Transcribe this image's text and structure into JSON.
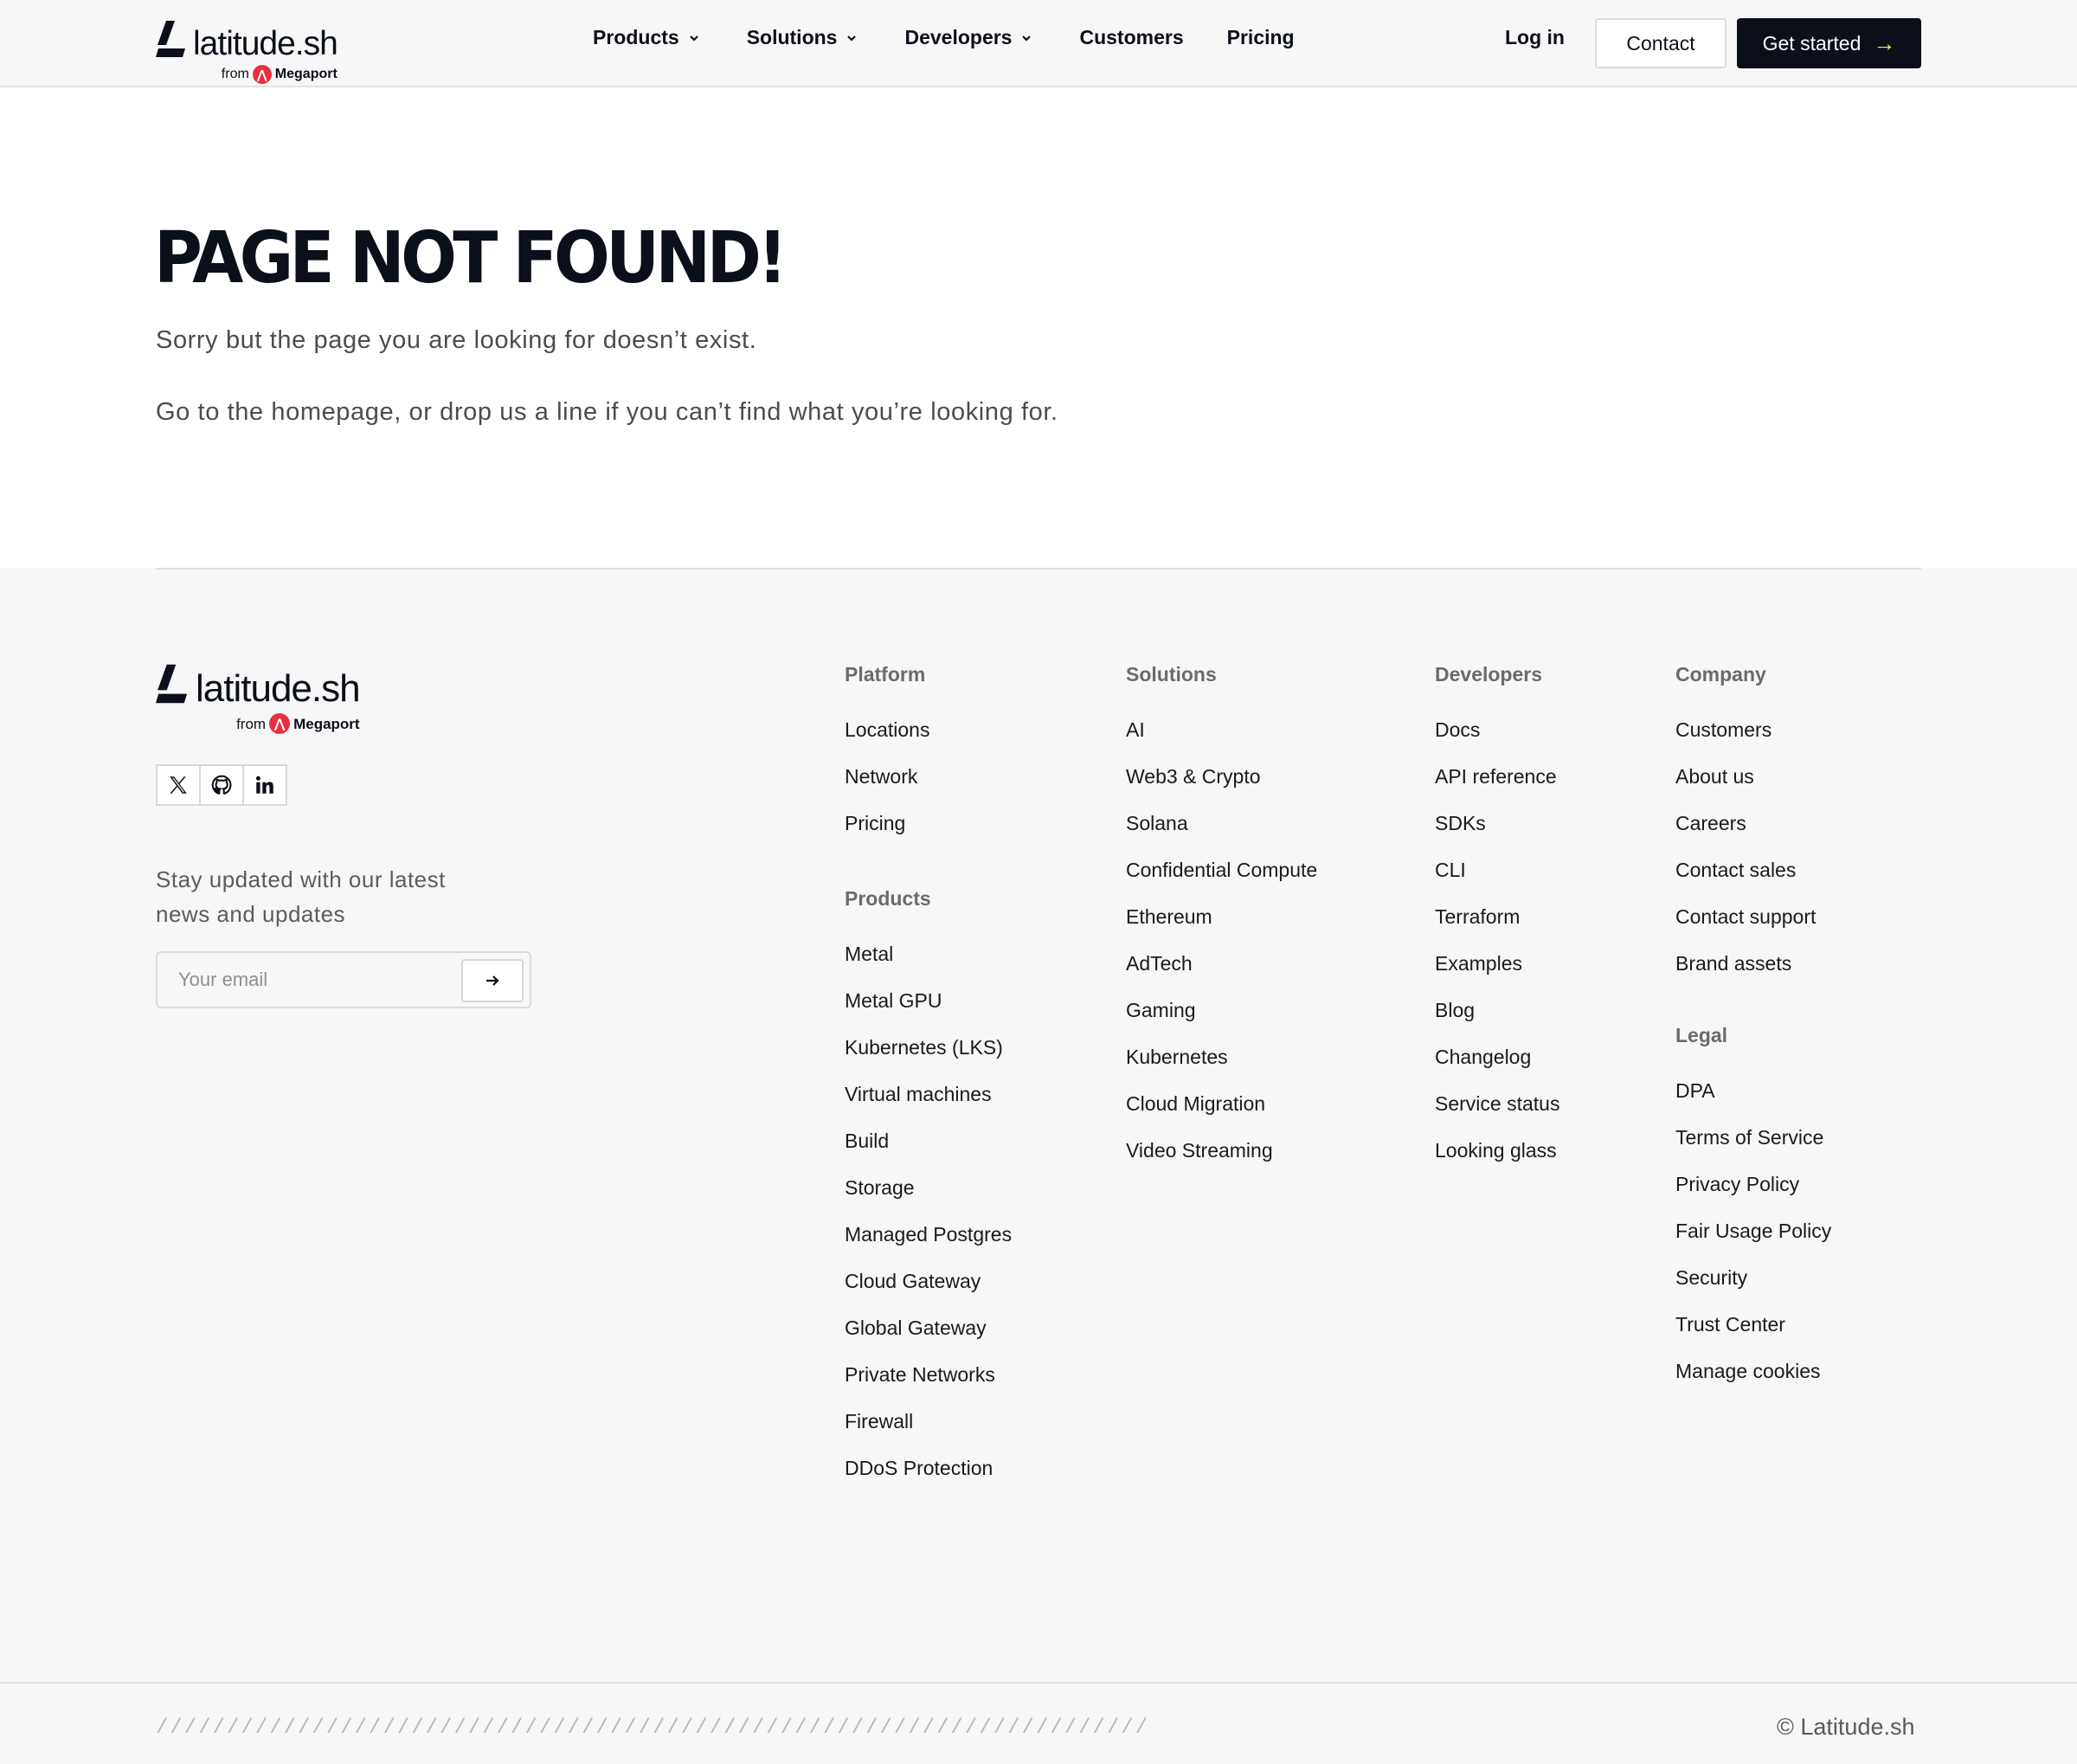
{
  "header": {
    "logo_text": "latitude.sh",
    "logo_from": "from",
    "logo_partner": "Megaport",
    "nav": [
      {
        "label": "Products",
        "dropdown": true
      },
      {
        "label": "Solutions",
        "dropdown": true
      },
      {
        "label": "Developers",
        "dropdown": true
      },
      {
        "label": "Customers",
        "dropdown": false
      },
      {
        "label": "Pricing",
        "dropdown": false
      }
    ],
    "login_label": "Log in",
    "contact_label": "Contact",
    "get_started_label": "Get started"
  },
  "main": {
    "title": "PAGE NOT FOUND!",
    "line1": "Sorry but the page you are looking for doesn’t exist.",
    "line2": "Go to the homepage, or drop us a line if you can’t find what you’re looking for."
  },
  "footer": {
    "logo_text": "latitude.sh",
    "logo_from": "from",
    "logo_partner": "Megaport",
    "socials": [
      "x-icon",
      "github-icon",
      "linkedin-icon"
    ],
    "newsletter": {
      "line1": "Stay updated with our latest",
      "line2": "news and updates",
      "placeholder": "Your email"
    },
    "columns": {
      "platform": {
        "heading": "Platform",
        "items": [
          "Locations",
          "Network",
          "Pricing"
        ]
      },
      "products": {
        "heading": "Products",
        "items": [
          "Metal",
          "Metal GPU",
          "Kubernetes (LKS)",
          "Virtual machines",
          "Build",
          "Storage",
          "Managed Postgres",
          "Cloud Gateway",
          "Global Gateway",
          "Private Networks",
          "Firewall",
          "DDoS Protection"
        ]
      },
      "solutions": {
        "heading": "Solutions",
        "items": [
          "AI",
          "Web3 & Crypto",
          "Solana",
          "Confidential Compute",
          "Ethereum",
          "AdTech",
          "Gaming",
          "Kubernetes",
          "Cloud Migration",
          "Video Streaming"
        ]
      },
      "developers": {
        "heading": "Developers",
        "items": [
          "Docs",
          "API reference",
          "SDKs",
          "CLI",
          "Terraform",
          "Examples",
          "Blog",
          "Changelog",
          "Service status",
          "Looking glass"
        ]
      },
      "company": {
        "heading": "Company",
        "items": [
          "Customers",
          "About us",
          "Careers",
          "Contact sales",
          "Contact support",
          "Brand assets"
        ]
      },
      "legal": {
        "heading": "Legal",
        "items": [
          "DPA",
          "Terms of Service",
          "Privacy Policy",
          "Fair Usage Policy",
          "Security",
          "Trust Center",
          "Manage cookies"
        ]
      }
    },
    "slashes": "//////////////////////////////////////////////////////////////////////",
    "copyright": "© Latitude.sh"
  },
  "colors": {
    "brand_dark": "#0b0f1a",
    "accent_yellow": "#f2f06a",
    "megaport_red": "#e5313e",
    "footer_bg": "#f7f7f7"
  }
}
